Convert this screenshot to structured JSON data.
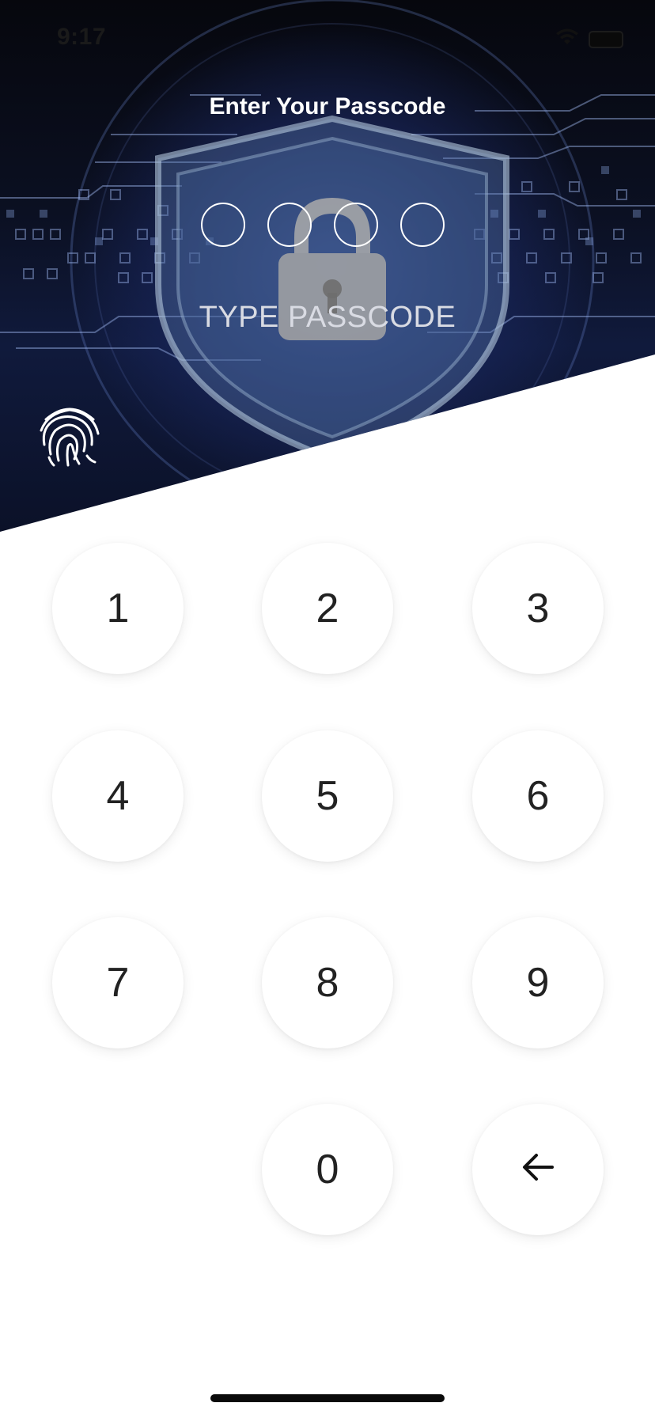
{
  "status_bar": {
    "time": "9:17",
    "icons": [
      "wifi-icon",
      "battery-icon"
    ]
  },
  "header": {
    "title": "Enter Your Passcode",
    "subtitle": "TYPE PASSCODE",
    "passcode_length": 4,
    "digits_entered": 0
  },
  "biometric": {
    "icon": "fingerprint-icon"
  },
  "keypad": {
    "keys": [
      "1",
      "2",
      "3",
      "4",
      "5",
      "6",
      "7",
      "8",
      "9",
      "0"
    ],
    "backspace_icon": "arrow-left-icon"
  },
  "colors": {
    "hero_dark": "#0b1022",
    "accent_blue": "#3b5bb5",
    "key_text": "#222222",
    "white": "#ffffff"
  }
}
